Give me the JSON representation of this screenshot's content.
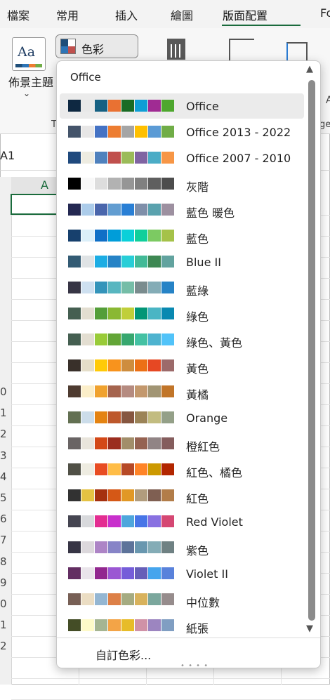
{
  "tabs": [
    {
      "label": "檔案"
    },
    {
      "label": "常用"
    },
    {
      "label": "插入"
    },
    {
      "label": "繪圖"
    },
    {
      "label": "版面配置"
    },
    {
      "label": "Fo"
    }
  ],
  "ribbon": {
    "theme_label": "佈景主題",
    "theme_icon_text": "Aa",
    "colors_label": "色彩",
    "group_t": "T",
    "group_ge": "ge",
    "group_a": "A"
  },
  "sheet": {
    "namebox": "A1",
    "column": "A",
    "rows": [
      "0",
      "1",
      "2",
      "3",
      "4",
      "5",
      "6",
      "7",
      "8",
      "9",
      "0",
      "1",
      "2"
    ]
  },
  "menu": {
    "section_label": "Office",
    "selected": "Office",
    "items": [
      {
        "label": "Office",
        "colors": [
          "#0e2841",
          "#e8e8e8",
          "#156082",
          "#e97132",
          "#196b24",
          "#0f9ed5",
          "#a02b93",
          "#4ea72e"
        ]
      },
      {
        "label": "Office 2013 - 2022",
        "colors": [
          "#44546a",
          "#e7e6e6",
          "#4472c4",
          "#ed7d31",
          "#a5a5a5",
          "#ffc000",
          "#5b9bd5",
          "#70ad47"
        ]
      },
      {
        "label": "Office 2007 - 2010",
        "colors": [
          "#1f497d",
          "#eeece1",
          "#4f81bd",
          "#c0504d",
          "#9bbb59",
          "#8064a2",
          "#4bacc6",
          "#f79646"
        ]
      },
      {
        "label": "灰階",
        "colors": [
          "#000000",
          "#f8f8f8",
          "#dddddd",
          "#b2b2b2",
          "#969696",
          "#808080",
          "#5f5f5f",
          "#4d4d4d"
        ]
      },
      {
        "label": "藍色 暖色",
        "colors": [
          "#242852",
          "#acccea",
          "#4a66ac",
          "#629dd1",
          "#297fd5",
          "#7f8fa9",
          "#5aa2ae",
          "#9d90a0"
        ]
      },
      {
        "label": "藍色",
        "colors": [
          "#17406d",
          "#dbeff9",
          "#0f6fc6",
          "#009dd9",
          "#0bd0d9",
          "#10cf9b",
          "#7cca62",
          "#a5c249"
        ]
      },
      {
        "label": "Blue II",
        "colors": [
          "#335b74",
          "#dfe3e5",
          "#1cade4",
          "#2683c6",
          "#27ced7",
          "#42ba97",
          "#3e8853",
          "#62a39f"
        ]
      },
      {
        "label": "藍綠",
        "colors": [
          "#373545",
          "#cee0f0",
          "#3494ba",
          "#58b6c0",
          "#75bda7",
          "#7a8c8e",
          "#84acb6",
          "#2683c6"
        ]
      },
      {
        "label": "綠色",
        "colors": [
          "#455f51",
          "#e3ded1",
          "#549e39",
          "#8ab833",
          "#c0cf3a",
          "#029676",
          "#4ab5c4",
          "#0989b1"
        ]
      },
      {
        "label": "綠色、黃色",
        "colors": [
          "#455f51",
          "#e3ded1",
          "#99cb38",
          "#63a537",
          "#37a76f",
          "#44c1a3",
          "#4eb3cf",
          "#51c3f9"
        ]
      },
      {
        "label": "黃色",
        "colors": [
          "#39302a",
          "#e5dec9",
          "#ffca08",
          "#f8931d",
          "#ce8d3e",
          "#ec7016",
          "#e64823",
          "#9c6a6a"
        ]
      },
      {
        "label": "黃橘",
        "colors": [
          "#4e3b30",
          "#fbeec9",
          "#f0a22e",
          "#a5644e",
          "#b58b80",
          "#c3986d",
          "#a19574",
          "#c17529"
        ]
      },
      {
        "label": "Orange",
        "colors": [
          "#637052",
          "#ccddea",
          "#e48312",
          "#bd582c",
          "#865640",
          "#9b8357",
          "#c2bc80",
          "#94a088"
        ]
      },
      {
        "label": "橙紅色",
        "colors": [
          "#696464",
          "#e9e5dc",
          "#d34817",
          "#9b2d1f",
          "#a28e6a",
          "#956251",
          "#918485",
          "#855d5d"
        ]
      },
      {
        "label": "紅色、橘色",
        "colors": [
          "#505046",
          "#eeece1",
          "#e84c22",
          "#ffbd47",
          "#b64926",
          "#ff8427",
          "#cc9900",
          "#b22600"
        ]
      },
      {
        "label": "紅色",
        "colors": [
          "#323232",
          "#e5c243",
          "#a5300f",
          "#d55816",
          "#e19825",
          "#b19c7d",
          "#7f5f52",
          "#b27d49"
        ]
      },
      {
        "label": "Red Violet",
        "colors": [
          "#454551",
          "#d8d9dc",
          "#e32d91",
          "#c830cc",
          "#4ea6dc",
          "#4775e7",
          "#8971e1",
          "#d54773"
        ]
      },
      {
        "label": "紫色",
        "colors": [
          "#373545",
          "#dcd8dc",
          "#ad84c6",
          "#8784c7",
          "#5d739a",
          "#6997af",
          "#84acb6",
          "#6f8183"
        ]
      },
      {
        "label": "Violet II",
        "colors": [
          "#632e62",
          "#eae5eb",
          "#92278f",
          "#9b57d3",
          "#755dd9",
          "#665eb8",
          "#45a5ed",
          "#5982db"
        ]
      },
      {
        "label": "中位數",
        "colors": [
          "#775f55",
          "#ebddc3",
          "#94b6d2",
          "#dd8047",
          "#a5ab81",
          "#d8b25c",
          "#7ba79d",
          "#968c8c"
        ]
      },
      {
        "label": "紙張",
        "colors": [
          "#444d26",
          "#fefac9",
          "#a5b592",
          "#f3a447",
          "#e7bc29",
          "#d092a7",
          "#9c85c0",
          "#809ec2"
        ]
      }
    ],
    "custom_label": "自訂色彩...",
    "custom_accel": "C",
    "scroll_up_icon": "▲",
    "scroll_down_icon": "▼"
  }
}
